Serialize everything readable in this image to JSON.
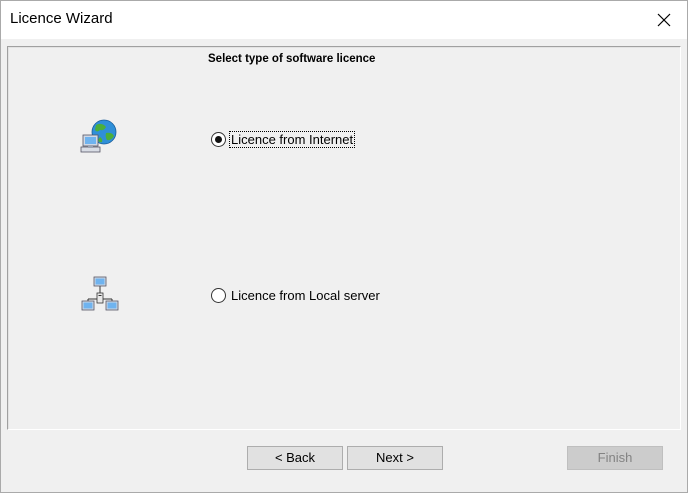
{
  "window": {
    "title": "Licence Wizard"
  },
  "main": {
    "heading": "Select type of software licence",
    "options": [
      {
        "label": "Licence from Internet",
        "selected": true,
        "icon": "globe-network-icon"
      },
      {
        "label": "Licence from Local server",
        "selected": false,
        "icon": "lan-network-icon"
      }
    ]
  },
  "footer": {
    "back_label": "< Back",
    "next_label": "Next >",
    "finish_label": "Finish",
    "finish_enabled": false
  }
}
